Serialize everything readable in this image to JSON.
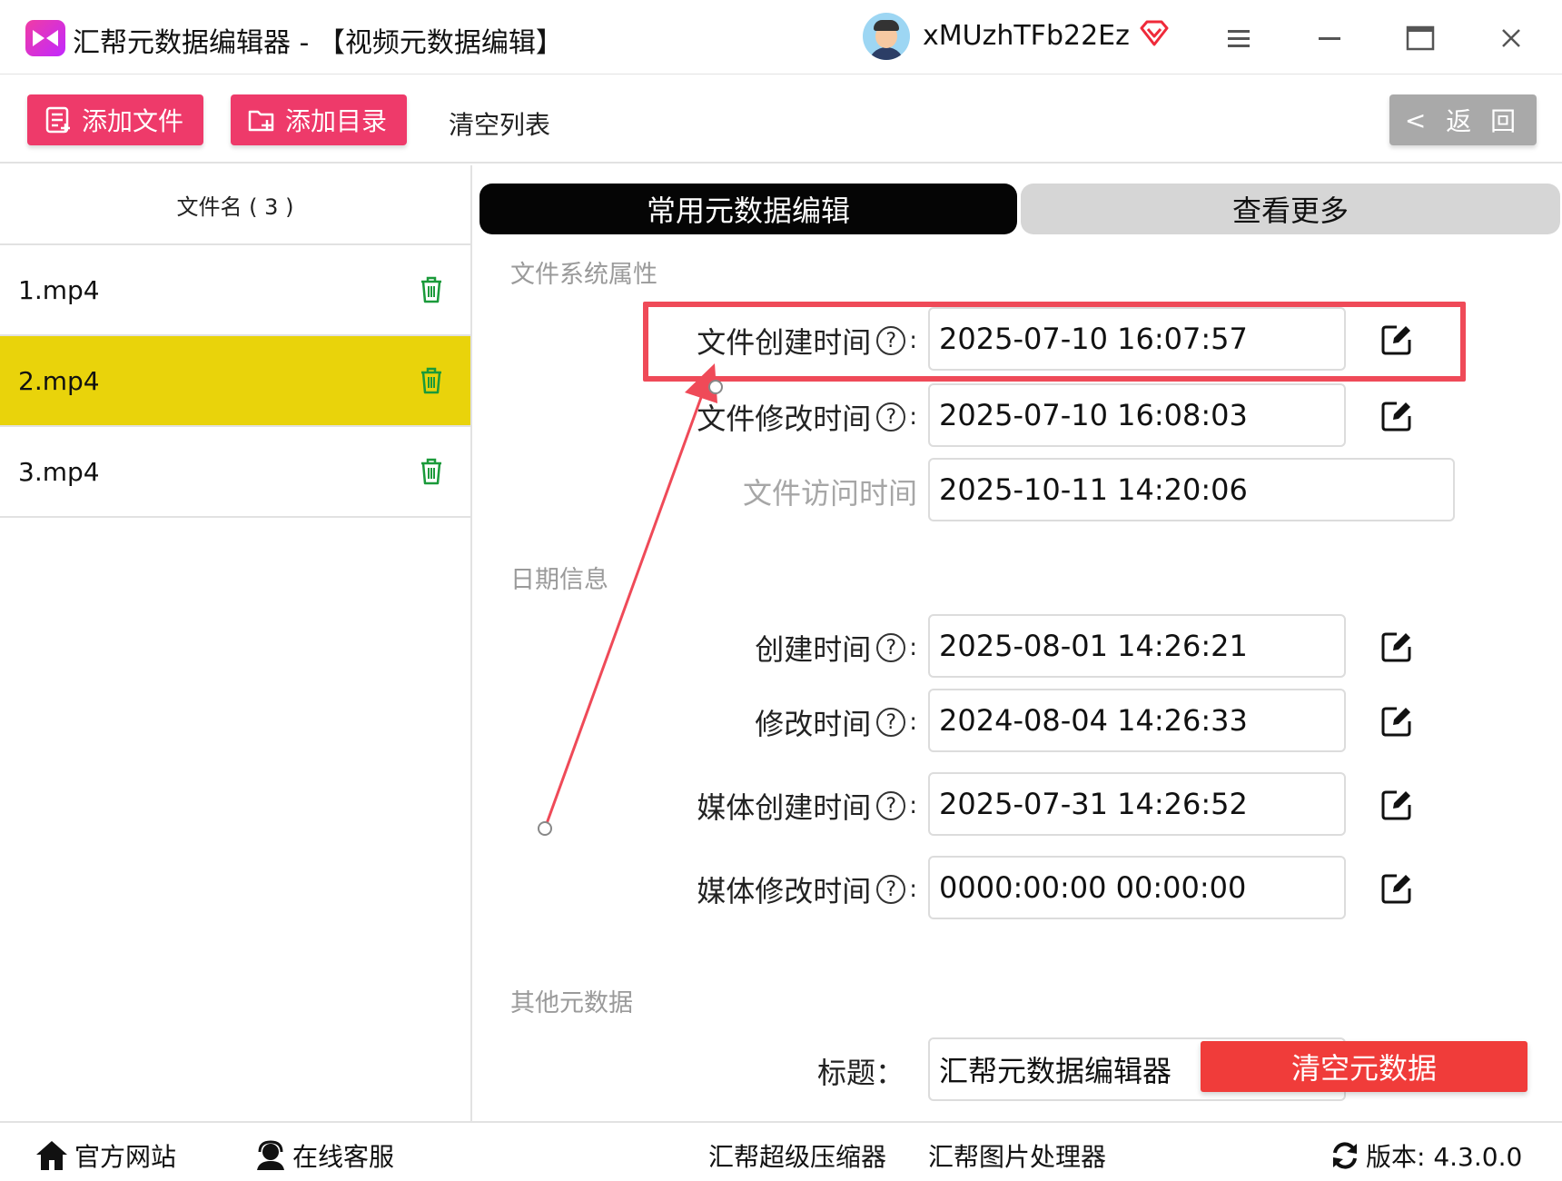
{
  "window": {
    "title": "汇帮元数据编辑器 - 【视频元数据编辑】",
    "username": "xMUzhTFb22Ez"
  },
  "toolbar": {
    "add_file": "添加文件",
    "add_dir": "添加目录",
    "clear_list": "清空列表",
    "back": "返 回",
    "back_chevron": "<"
  },
  "sidebar": {
    "header": "文件名 ( 3 )",
    "files": [
      {
        "name": "1.mp4"
      },
      {
        "name": "2.mp4"
      },
      {
        "name": "3.mp4"
      }
    ]
  },
  "tabs": {
    "active": "常用元数据编辑",
    "more": "查看更多"
  },
  "sections": {
    "filesystem": "文件系统属性",
    "date": "日期信息",
    "other": "其他元数据"
  },
  "fields": {
    "file_created": {
      "label": "文件创建时间",
      "value": "2025-07-10 16:07:57"
    },
    "file_modified": {
      "label": "文件修改时间",
      "value": "2025-07-10 16:08:03"
    },
    "file_accessed": {
      "label": "文件访问时间",
      "value": "2025-10-11 14:20:06"
    },
    "created": {
      "label": "创建时间",
      "value": "2025-08-01 14:26:21"
    },
    "modified": {
      "label": "修改时间",
      "value": "2024-08-04 14:26:33"
    },
    "media_created": {
      "label": "媒体创建时间",
      "value": "2025-07-31 14:26:52"
    },
    "media_modified": {
      "label": "媒体修改时间",
      "value": "0000:00:00 00:00:00"
    },
    "title": {
      "label": "标题：",
      "value": "汇帮元数据编辑器"
    }
  },
  "help_glyph": "?",
  "colon": ":",
  "clear_metadata": "清空元数据",
  "footer": {
    "website": "官方网站",
    "support": "在线客服",
    "compressor": "汇帮超级压缩器",
    "image_tool": "汇帮图片处理器",
    "version": "版本:  4.3.0.0"
  },
  "colors": {
    "accent_pink": "#ee3a6a",
    "selected_row": "#e9d30b",
    "highlight_red": "#ef4a58",
    "clear_button": "#f03c3a"
  }
}
